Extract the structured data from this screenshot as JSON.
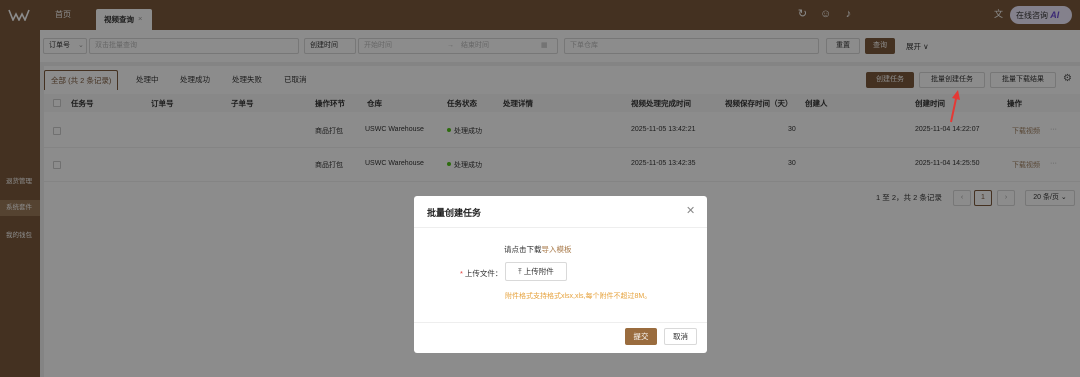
{
  "topbar": {
    "tab_home": "首页",
    "tab_active": "视频查询",
    "tab_close": "×",
    "ai_button_text": "在线咨询",
    "ai_badge": "AI",
    "icons": [
      "refresh-icon",
      "help-icon",
      "bell-icon",
      "translate-icon"
    ]
  },
  "sidebar": {
    "items": [
      {
        "label": "退货管理"
      },
      {
        "label": "系统套件"
      },
      {
        "label": "我的钱包"
      }
    ]
  },
  "filters": {
    "order_type_label": "订单号",
    "order_placeholder": "双击批量查询",
    "created_time_label": "创建时间",
    "start_placeholder": "开始时间",
    "arrow": "→",
    "end_placeholder": "结束时间",
    "warehouse_placeholder": "下单仓库",
    "reset_label": "重置",
    "search_label": "查询",
    "expand_label": "展开"
  },
  "tabs": {
    "all": "全部 (共 2 条记录)",
    "processing": "处理中",
    "success": "处理成功",
    "failed": "处理失败",
    "cancelled": "已取消"
  },
  "actions": {
    "create_task": "创建任务",
    "batch_create_task": "批量创建任务",
    "batch_download": "批量下载结果"
  },
  "table": {
    "headers": [
      "任务号",
      "订单号",
      "子单号",
      "操作环节",
      "仓库",
      "任务状态",
      "处理详情",
      "视频处理完成时间",
      "视频保存时间（天）",
      "创建人",
      "创建时间",
      "操作"
    ],
    "rows": [
      {
        "step": "商品打包",
        "warehouse": "USWC Warehouse",
        "status": "处理成功",
        "done_time": "2025-11-05 13:42:21",
        "keep_days": "30",
        "created_time": "2025-11-04 14:22:07",
        "action": "下载视频",
        "more": "···"
      },
      {
        "step": "商品打包",
        "warehouse": "USWC Warehouse",
        "status": "处理成功",
        "done_time": "2025-11-05 13:42:35",
        "keep_days": "30",
        "created_time": "2025-11-04 14:25:50",
        "action": "下载视频",
        "more": "···"
      }
    ]
  },
  "pagination": {
    "summary": "1 至 2，共 2 条记录",
    "current_page": "1",
    "page_size": "20 条/页"
  },
  "modal": {
    "title": "批量创建任务",
    "hint_prefix": "请点击下载",
    "hint_link": "导入模板",
    "upload_label": "上传文件：",
    "required_mark": "*",
    "upload_button": "上传附件",
    "note": "附件格式支持格式xlsx,xls,每个附件不超过8M。",
    "submit_label": "提交",
    "cancel_label": "取消"
  },
  "colors": {
    "brand": "#7c5a3c",
    "accent_link": "#a87a4a",
    "warning_note": "#e6a23c",
    "success_dot": "#52c41a",
    "annotation_arrow": "#e53935"
  }
}
